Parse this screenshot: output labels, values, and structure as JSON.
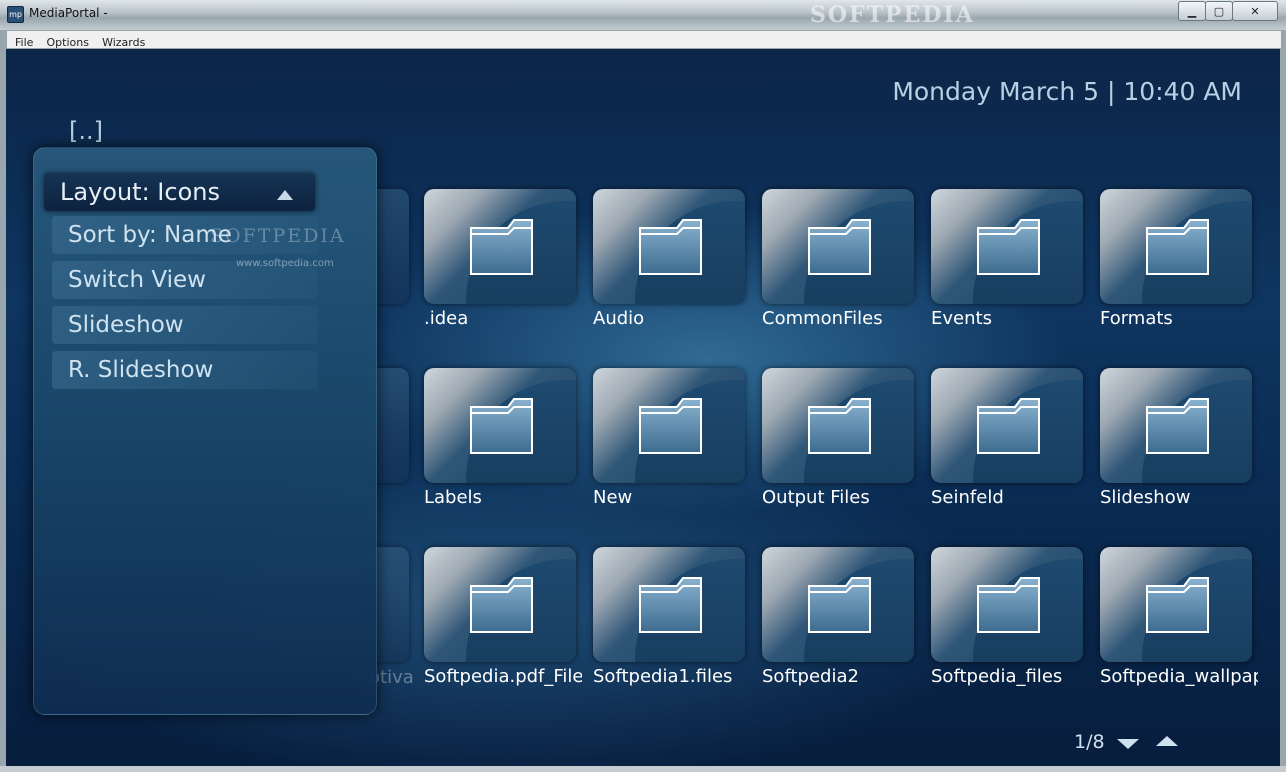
{
  "window": {
    "title": "MediaPortal -",
    "app_icon_text": "mp",
    "watermark": "SOFTPEDIA",
    "controls": {
      "minimize": "▁",
      "maximize": "▢",
      "close": "✕"
    }
  },
  "menubar": {
    "items": [
      "File",
      "Options",
      "Wizards"
    ]
  },
  "clock": "Monday March 5 | 10:40 AM",
  "up_dir": "[..]",
  "side_menu": {
    "items": [
      {
        "label": "Layout: Icons",
        "selected": true
      },
      {
        "label": "Sort by: Name",
        "icon": "sort-ascending-icon"
      },
      {
        "label": "Switch View"
      },
      {
        "label": "Slideshow"
      },
      {
        "label": "R. Slideshow"
      }
    ],
    "watermark": "SOFTPEDIA",
    "watermark_url": "www.softpedia.com"
  },
  "grid": {
    "partial_label": "otiva",
    "folders": [
      ".idea",
      "Audio",
      "CommonFiles",
      "Events",
      "Formats",
      "Labels",
      "New",
      "Output Files",
      "Seinfeld",
      "Slideshow",
      "Softpedia.pdf_Files",
      "Softpedia1.files",
      "Softpedia2",
      "Softpedia_files",
      "Softpedia_wallpapers"
    ]
  },
  "pager": {
    "text": "1/8",
    "icons": [
      "page-down-icon",
      "page-up-icon"
    ]
  },
  "colors": {
    "accent": "#b9cfe4",
    "background": "#0e3560",
    "label": "#ffffff"
  }
}
